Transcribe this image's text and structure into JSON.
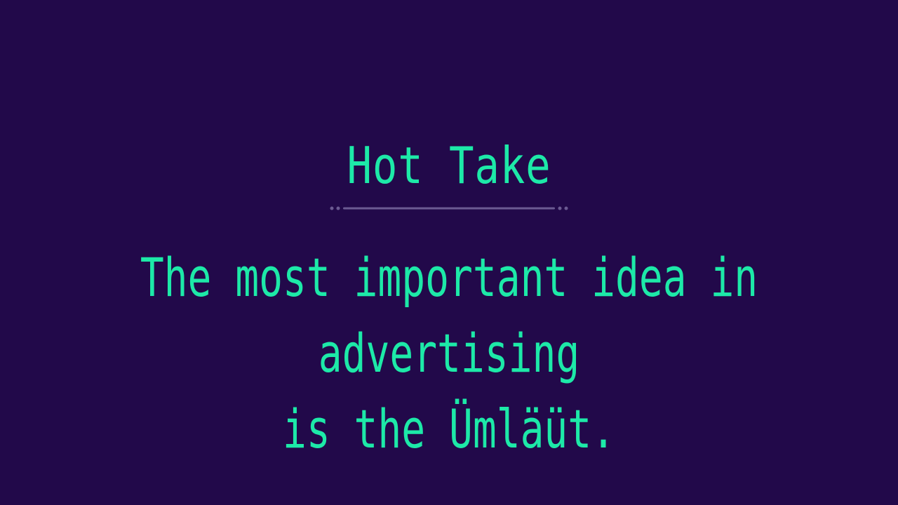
{
  "slide": {
    "title": "Hot Take",
    "quote": "The most important idea in advertising\nis the Ümläüt.",
    "colors": {
      "background": "#22094a",
      "accent": "#1de9a8",
      "divider": "#6b5a92"
    }
  }
}
